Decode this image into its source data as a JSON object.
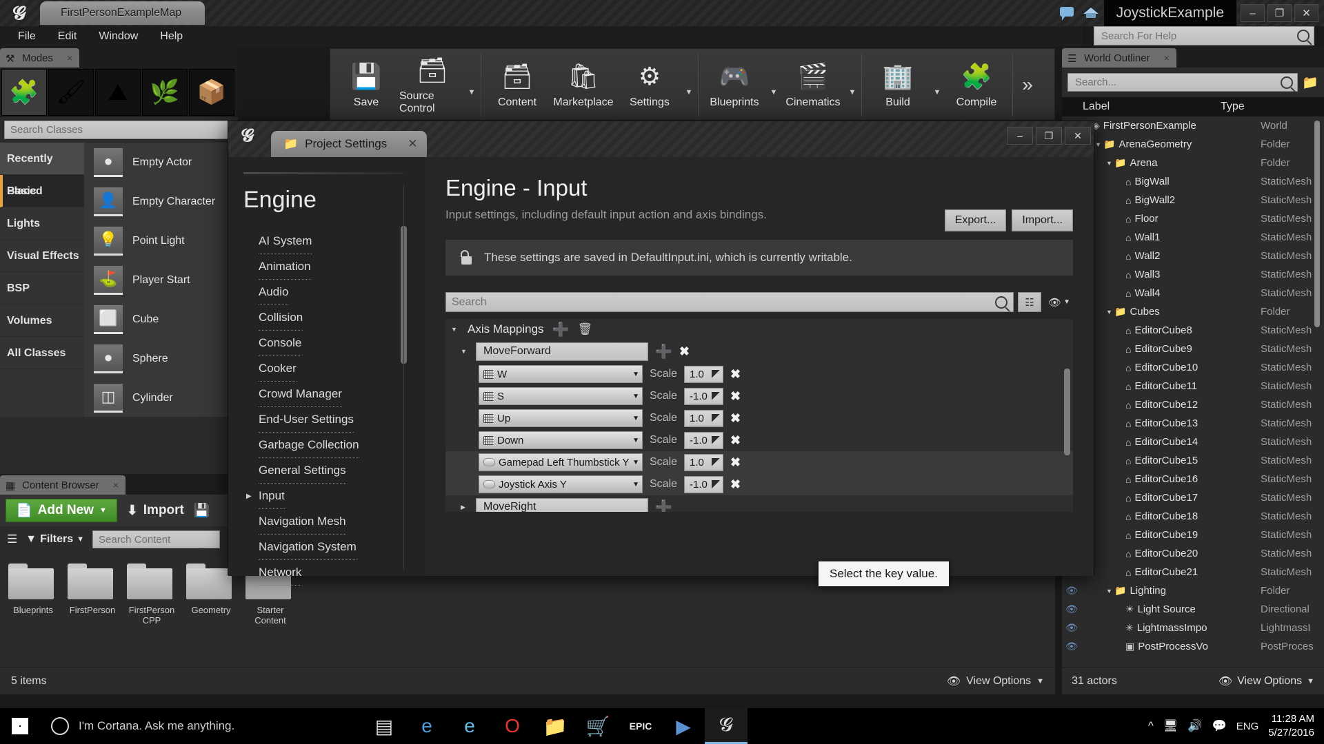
{
  "titlebar": {
    "map_tab": "FirstPersonExampleMap",
    "project_name": "JoystickExample",
    "minimize": "–",
    "restore": "❐",
    "close": "✕"
  },
  "menubar": {
    "items": [
      "File",
      "Edit",
      "Window",
      "Help"
    ]
  },
  "help_search": {
    "placeholder": "Search For Help"
  },
  "modes": {
    "tab_label": "Modes",
    "close": "×",
    "mode_buttons": [
      "place-mode",
      "paint-mode",
      "landscape-mode",
      "foliage-mode",
      "geometry-edit-mode"
    ],
    "search_placeholder": "Search Classes",
    "categories": [
      {
        "label": "Recently Placed",
        "state": "hover"
      },
      {
        "label": "Basic",
        "state": "selected"
      },
      {
        "label": "Lights",
        "state": "normal"
      },
      {
        "label": "Visual Effects",
        "state": "normal"
      },
      {
        "label": "BSP",
        "state": "normal"
      },
      {
        "label": "Volumes",
        "state": "normal"
      },
      {
        "label": "All Classes",
        "state": "normal"
      }
    ],
    "items": [
      {
        "label": "Empty Actor",
        "icon": "sphere-thumb"
      },
      {
        "label": "Empty Character",
        "icon": "character-thumb"
      },
      {
        "label": "Point Light",
        "icon": "bulb-thumb"
      },
      {
        "label": "Player Start",
        "icon": "flag-thumb"
      },
      {
        "label": "Cube",
        "icon": "cube-thumb"
      },
      {
        "label": "Sphere",
        "icon": "sphere-thumb"
      },
      {
        "label": "Cylinder",
        "icon": "cylinder-thumb"
      }
    ]
  },
  "toolbar": {
    "groups": [
      {
        "items": [
          {
            "label": "Save",
            "icon": "save-icon",
            "caret": false
          },
          {
            "label": "Source Control",
            "icon": "source-control-icon",
            "caret": true
          }
        ]
      },
      {
        "items": [
          {
            "label": "Content",
            "icon": "content-icon",
            "caret": false
          },
          {
            "label": "Marketplace",
            "icon": "marketplace-icon",
            "caret": false
          },
          {
            "label": "Settings",
            "icon": "settings-gear-icon",
            "caret": true
          }
        ]
      },
      {
        "items": [
          {
            "label": "Blueprints",
            "icon": "blueprints-icon",
            "caret": true
          },
          {
            "label": "Cinematics",
            "icon": "cinematics-icon",
            "caret": true
          }
        ]
      },
      {
        "items": [
          {
            "label": "Build",
            "icon": "build-icon",
            "caret": true
          },
          {
            "label": "Compile",
            "icon": "compile-icon",
            "caret": false
          }
        ]
      }
    ],
    "overflow": "»"
  },
  "content_browser": {
    "tab_label": "Content Browser",
    "close": "×",
    "add_new": "Add New",
    "import": "Import",
    "save_all": "Save All",
    "filters": "Filters",
    "search_placeholder": "Search Content",
    "folders": [
      "Blueprints",
      "FirstPerson",
      "FirstPerson CPP",
      "Geometry",
      "Starter Content"
    ],
    "status": "5 items",
    "view_options": "View Options"
  },
  "outliner": {
    "tab_label": "World Outliner",
    "close": "×",
    "search_placeholder": "Search...",
    "columns": {
      "label": "Label",
      "type": "Type"
    },
    "rows": [
      {
        "name": "FirstPersonExample",
        "type": "World",
        "depth": 0,
        "icon": "world-icon",
        "expander": "",
        "eye": false
      },
      {
        "name": "ArenaGeometry",
        "type": "Folder",
        "depth": 1,
        "icon": "folder-icon",
        "expander": "▼",
        "eye": false
      },
      {
        "name": "Arena",
        "type": "Folder",
        "depth": 2,
        "icon": "folder-icon",
        "expander": "▼",
        "eye": false
      },
      {
        "name": "BigWall",
        "type": "StaticMesh",
        "depth": 3,
        "icon": "mesh-icon",
        "expander": "",
        "eye": false
      },
      {
        "name": "BigWall2",
        "type": "StaticMesh",
        "depth": 3,
        "icon": "mesh-icon",
        "expander": "",
        "eye": false
      },
      {
        "name": "Floor",
        "type": "StaticMesh",
        "depth": 3,
        "icon": "mesh-icon",
        "expander": "",
        "eye": false
      },
      {
        "name": "Wall1",
        "type": "StaticMesh",
        "depth": 3,
        "icon": "mesh-icon",
        "expander": "",
        "eye": false
      },
      {
        "name": "Wall2",
        "type": "StaticMesh",
        "depth": 3,
        "icon": "mesh-icon",
        "expander": "",
        "eye": false
      },
      {
        "name": "Wall3",
        "type": "StaticMesh",
        "depth": 3,
        "icon": "mesh-icon",
        "expander": "",
        "eye": false
      },
      {
        "name": "Wall4",
        "type": "StaticMesh",
        "depth": 3,
        "icon": "mesh-icon",
        "expander": "",
        "eye": false
      },
      {
        "name": "Cubes",
        "type": "Folder",
        "depth": 2,
        "icon": "folder-icon",
        "expander": "▼",
        "eye": false
      },
      {
        "name": "EditorCube8",
        "type": "StaticMesh",
        "depth": 3,
        "icon": "mesh-icon",
        "expander": "",
        "eye": false
      },
      {
        "name": "EditorCube9",
        "type": "StaticMesh",
        "depth": 3,
        "icon": "mesh-icon",
        "expander": "",
        "eye": false
      },
      {
        "name": "EditorCube10",
        "type": "StaticMesh",
        "depth": 3,
        "icon": "mesh-icon",
        "expander": "",
        "eye": false
      },
      {
        "name": "EditorCube11",
        "type": "StaticMesh",
        "depth": 3,
        "icon": "mesh-icon",
        "expander": "",
        "eye": false
      },
      {
        "name": "EditorCube12",
        "type": "StaticMesh",
        "depth": 3,
        "icon": "mesh-icon",
        "expander": "",
        "eye": false
      },
      {
        "name": "EditorCube13",
        "type": "StaticMesh",
        "depth": 3,
        "icon": "mesh-icon",
        "expander": "",
        "eye": false
      },
      {
        "name": "EditorCube14",
        "type": "StaticMesh",
        "depth": 3,
        "icon": "mesh-icon",
        "expander": "",
        "eye": false
      },
      {
        "name": "EditorCube15",
        "type": "StaticMesh",
        "depth": 3,
        "icon": "mesh-icon",
        "expander": "",
        "eye": false
      },
      {
        "name": "EditorCube16",
        "type": "StaticMesh",
        "depth": 3,
        "icon": "mesh-icon",
        "expander": "",
        "eye": false
      },
      {
        "name": "EditorCube17",
        "type": "StaticMesh",
        "depth": 3,
        "icon": "mesh-icon",
        "expander": "",
        "eye": false
      },
      {
        "name": "EditorCube18",
        "type": "StaticMesh",
        "depth": 3,
        "icon": "mesh-icon",
        "expander": "",
        "eye": false
      },
      {
        "name": "EditorCube19",
        "type": "StaticMesh",
        "depth": 3,
        "icon": "mesh-icon",
        "expander": "",
        "eye": false
      },
      {
        "name": "EditorCube20",
        "type": "StaticMesh",
        "depth": 3,
        "icon": "mesh-icon",
        "expander": "",
        "eye": true
      },
      {
        "name": "EditorCube21",
        "type": "StaticMesh",
        "depth": 3,
        "icon": "mesh-icon",
        "expander": "",
        "eye": true
      },
      {
        "name": "Lighting",
        "type": "Folder",
        "depth": 2,
        "icon": "folder-icon",
        "expander": "▼",
        "eye": true
      },
      {
        "name": "Light Source",
        "type": "Directional",
        "depth": 3,
        "icon": "light-icon",
        "expander": "",
        "eye": true
      },
      {
        "name": "LightmassImpo",
        "type": "LightmassI",
        "depth": 3,
        "icon": "lightmass-icon",
        "expander": "",
        "eye": true
      },
      {
        "name": "PostProcessVo",
        "type": "PostProces",
        "depth": 3,
        "icon": "postprocess-icon",
        "expander": "",
        "eye": true
      }
    ],
    "status": "31 actors",
    "view_options": "View Options"
  },
  "dialog": {
    "tab_label": "Project Settings",
    "window_buttons": {
      "minimize": "–",
      "restore": "❐",
      "close": "✕"
    },
    "nav": {
      "title": "Engine",
      "items": [
        {
          "label": "AI System",
          "expandable": false
        },
        {
          "label": "Animation",
          "expandable": false
        },
        {
          "label": "Audio",
          "expandable": false
        },
        {
          "label": "Collision",
          "expandable": false
        },
        {
          "label": "Console",
          "expandable": false
        },
        {
          "label": "Cooker",
          "expandable": false
        },
        {
          "label": "Crowd Manager",
          "expandable": false
        },
        {
          "label": "End-User Settings",
          "expandable": false
        },
        {
          "label": "Garbage Collection",
          "expandable": false
        },
        {
          "label": "General Settings",
          "expandable": false
        },
        {
          "label": "Input",
          "expandable": true
        },
        {
          "label": "Navigation Mesh",
          "expandable": false
        },
        {
          "label": "Navigation System",
          "expandable": false
        },
        {
          "label": "Network",
          "expandable": false
        }
      ]
    },
    "heading": "Engine - Input",
    "subheading": "Input settings, including default input action and axis bindings.",
    "export_button": "Export...",
    "import_button": "Import...",
    "notice": "These settings are saved in DefaultInput.ini, which is currently writable.",
    "search_placeholder": "Search",
    "axis_mappings": {
      "section_label": "Axis Mappings",
      "scale_label": "Scale",
      "groups": [
        {
          "name": "MoveForward",
          "expanded": true,
          "bindings": [
            {
              "key": "W",
              "scale": "1.0",
              "device": "keyboard"
            },
            {
              "key": "S",
              "scale": "-1.0",
              "device": "keyboard"
            },
            {
              "key": "Up",
              "scale": "1.0",
              "device": "keyboard"
            },
            {
              "key": "Down",
              "scale": "-1.0",
              "device": "keyboard"
            },
            {
              "key": "Gamepad Left Thumbstick Y-Axis",
              "scale": "1.0",
              "device": "gamepad"
            },
            {
              "key": "Joystick Axis Y",
              "scale": "-1.0",
              "device": "gamepad"
            }
          ]
        },
        {
          "name": "MoveRight",
          "expanded": false,
          "bindings": []
        }
      ]
    },
    "tooltip": "Select the key value."
  },
  "taskbar": {
    "cortana_text": "I'm Cortana. Ask me anything.",
    "apps": [
      "task-view-icon",
      "edge-icon",
      "internet-explorer-icon",
      "opera-icon",
      "file-explorer-icon",
      "store-icon",
      "epic-games-icon",
      "vlc-icon",
      "unreal-editor-icon"
    ],
    "language": "ENG",
    "time": "11:28 AM",
    "date": "5/27/2016"
  }
}
